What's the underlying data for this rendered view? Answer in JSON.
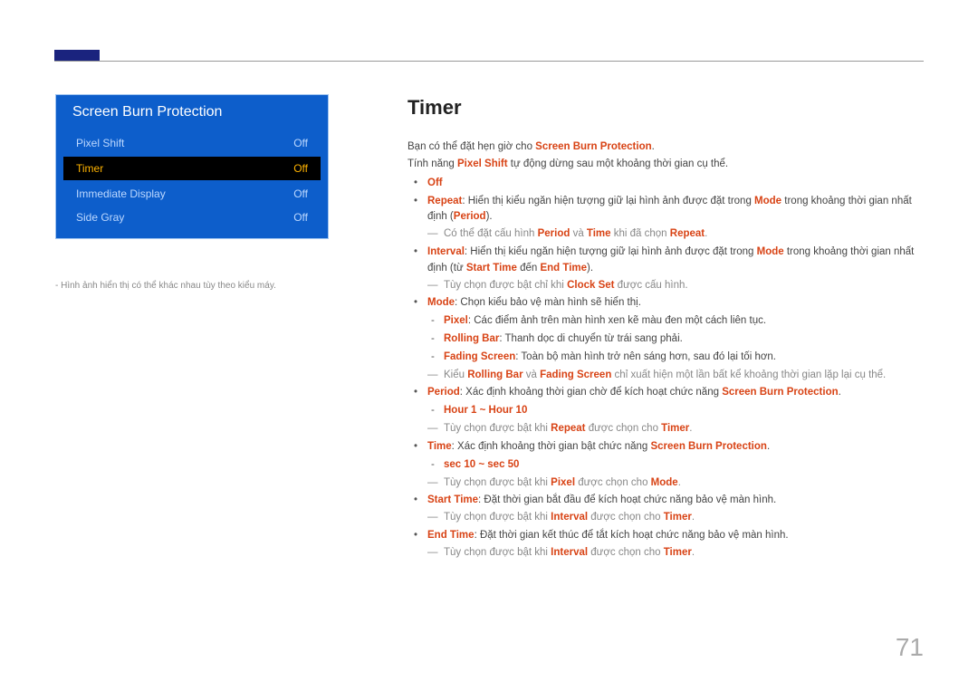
{
  "menu": {
    "title": "Screen Burn Protection",
    "items": [
      {
        "label": "Pixel Shift",
        "value": "Off",
        "selected": false
      },
      {
        "label": "Timer",
        "value": "Off",
        "selected": true
      },
      {
        "label": "Immediate Display",
        "value": "Off",
        "selected": false
      },
      {
        "label": "Side Gray",
        "value": "Off",
        "selected": false
      }
    ],
    "caption": "Hình ảnh hiển thị có thể khác nhau tùy theo kiểu máy."
  },
  "heading": "Timer",
  "intro1_a": "Bạn có thể đặt hẹn giờ cho ",
  "intro1_hl": "Screen Burn Protection",
  "intro2_a": "Tính năng ",
  "intro2_hl": "Pixel Shift",
  "intro2_b": " tự động dừng sau một khoảng thời gian cụ thể.",
  "off_label": "Off",
  "repeat": {
    "hl": "Repeat",
    "text_a": ": Hiển thị kiểu ngăn hiện tượng giữ lại hình ảnh được đặt trong ",
    "mode_hl": "Mode",
    "text_b": " trong khoảng thời gian nhất định (",
    "period_hl": "Period",
    "text_c": ").",
    "note_a": "Có thể đặt cấu hình ",
    "note_period": "Period",
    "note_mid": " và ",
    "note_time": "Time",
    "note_b": " khi đã chọn ",
    "note_repeat": "Repeat",
    "note_end": "."
  },
  "interval": {
    "hl": "Interval",
    "text_a": ": Hiển thị kiểu ngăn hiện tượng giữ lại hình ảnh được đặt trong ",
    "mode_hl": "Mode",
    "text_b": " trong khoảng thời gian nhất định (từ ",
    "start_hl": "Start Time",
    "mid": " đến ",
    "end_hl": "End Time",
    "text_c": ").",
    "note_a": "Tùy chọn được bật chỉ khi ",
    "clock_hl": "Clock Set",
    "note_b": " được cấu hình."
  },
  "mode": {
    "hl": "Mode",
    "text": ": Chọn kiểu bảo vệ màn hình sẽ hiển thị.",
    "pixel_hl": "Pixel",
    "pixel_text": ": Các điểm ảnh trên màn hình xen kẽ màu đen một cách liên tục.",
    "rolling_hl": "Rolling Bar",
    "rolling_text": ": Thanh dọc di chuyển từ trái sang phải.",
    "fading_hl": "Fading Screen",
    "fading_text": ": Toàn bộ màn hình trở nên sáng hơn, sau đó lại tối hơn.",
    "note_a": "Kiểu ",
    "note_r": "Rolling Bar",
    "note_mid": " và ",
    "note_f": "Fading Screen",
    "note_b": " chỉ xuất hiện một lần bất kể khoảng thời gian lặp lại cụ thể."
  },
  "period": {
    "hl": "Period",
    "text_a": ": Xác định khoảng thời gian chờ để kích hoạt chức năng ",
    "sbp_hl": "Screen Burn Protection",
    "range": "Hour 1 ~ Hour 10",
    "note_a": "Tùy chọn được bật khi ",
    "note_r": "Repeat",
    "note_b": " được chọn cho ",
    "note_t": "Timer",
    "dot": "."
  },
  "time": {
    "hl": "Time",
    "text_a": ": Xác định khoảng thời gian bật chức năng ",
    "sbp_hl": "Screen Burn Protection",
    "range": "sec 10 ~ sec 50",
    "note_a": "Tùy chọn được bật khi ",
    "note_r": "Pixel",
    "note_b": " được chọn cho ",
    "note_t": "Mode",
    "dot": "."
  },
  "starttime": {
    "hl": "Start Time",
    "text": ": Đặt thời gian bắt đầu để kích hoạt chức năng bảo vệ màn hình.",
    "note_a": "Tùy chọn được bật khi ",
    "note_r": "Interval",
    "note_b": " được chọn cho ",
    "note_t": "Timer",
    "dot": "."
  },
  "endtime": {
    "hl": "End Time",
    "text": ": Đặt thời gian kết thúc để tắt kích hoạt chức năng bảo vệ màn hình.",
    "note_a": "Tùy chọn được bật khi ",
    "note_r": "Interval",
    "note_b": " được chọn cho ",
    "note_t": "Timer",
    "dot": "."
  },
  "page_number": "71"
}
